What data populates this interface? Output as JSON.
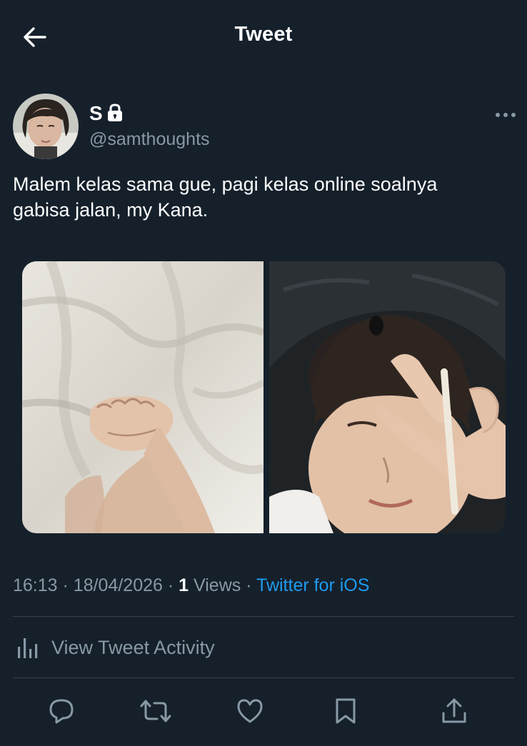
{
  "header": {
    "title": "Tweet",
    "back_icon": "arrow-left-icon"
  },
  "author": {
    "display_name": "S",
    "handle": "@samthoughts",
    "protected_icon": "lock-icon"
  },
  "tweet": {
    "text_line1": "Malem kelas sama gue, pagi kelas online soalnya",
    "text_line2": "gabisa jalan, my Kana.",
    "media": [
      {
        "alt": "hands-on-sheets-photo"
      },
      {
        "alt": "selfie-photo"
      }
    ]
  },
  "meta": {
    "time": "16:13",
    "date": "18/04/2026",
    "views_count": "1",
    "views_label": "Views",
    "source": "Twitter for iOS",
    "separator": "·"
  },
  "activity": {
    "label": "View Tweet Activity",
    "icon": "bar-chart-icon"
  },
  "actions": {
    "reply_icon": "reply-icon",
    "retweet_icon": "retweet-icon",
    "like_icon": "heart-icon",
    "bookmark_icon": "bookmark-icon",
    "share_icon": "share-icon"
  },
  "colors": {
    "background": "#15202b",
    "text_primary": "#ffffff",
    "text_secondary": "#8899a6",
    "accent": "#1d9bf0",
    "divider": "#38444d"
  }
}
